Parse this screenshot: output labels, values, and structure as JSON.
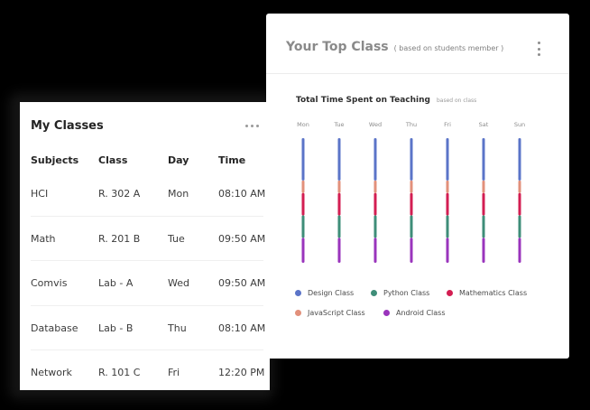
{
  "my_classes": {
    "title": "My Classes",
    "menu_icon": "ellipsis-icon",
    "headers": [
      "Subjects",
      "Class",
      "Day",
      "Time"
    ],
    "rows": [
      [
        "HCI",
        "R. 302 A",
        "Mon",
        "08:10 AM"
      ],
      [
        "Math",
        "R. 201 B",
        "Tue",
        "09:50 AM"
      ],
      [
        "Comvis",
        "Lab - A",
        "Wed",
        "09:50 AM"
      ],
      [
        "Database",
        "Lab - B",
        "Thu",
        "08:10 AM"
      ],
      [
        "Network",
        "R. 101 C",
        "Fri",
        "12:20 PM"
      ]
    ]
  },
  "top_class": {
    "title": "Your Top Class",
    "subtitle": "( based on students member )",
    "menu_icon": "vertical-ellipsis-icon",
    "chart_title": "Total Time Spent on Teaching",
    "chart_subtitle": "based on class"
  },
  "chart_data": {
    "type": "bar",
    "categories": [
      "Mon",
      "Tue",
      "Wed",
      "Thu",
      "Fri",
      "Sat",
      "Sun"
    ],
    "series": [
      {
        "name": "Design Class",
        "color": "#5b74c8",
        "values": [
          1.7,
          1.7,
          1.7,
          1.7,
          1.7,
          1.7,
          1.7
        ]
      },
      {
        "name": "JavaScript Class",
        "color": "#e2907b",
        "values": [
          0.5,
          0.5,
          0.5,
          0.5,
          0.5,
          0.5,
          0.5
        ]
      },
      {
        "name": "Mathematics Class",
        "color": "#d31e52",
        "values": [
          0.9,
          0.9,
          0.9,
          0.9,
          0.9,
          0.9,
          0.9
        ]
      },
      {
        "name": "Python Class",
        "color": "#3e8d78",
        "values": [
          0.9,
          0.9,
          0.9,
          0.9,
          0.9,
          0.9,
          0.9
        ]
      },
      {
        "name": "Android Class",
        "color": "#9a34bc",
        "values": [
          1.0,
          1.0,
          1.0,
          1.0,
          1.0,
          1.0,
          1.0
        ]
      }
    ],
    "stacked": true,
    "title": "Total Time Spent on Teaching",
    "subtitle": "based on class",
    "xlabel": "",
    "ylabel": "",
    "legend": {
      "placement": "bottom",
      "rows": [
        [
          "Design Class",
          "Python Class",
          "Mathematics Class"
        ],
        [
          "JavaScript Class",
          "Android Class"
        ]
      ]
    }
  },
  "colors": {
    "background": "#000000",
    "card": "#ffffff",
    "divider": "#ececec"
  }
}
